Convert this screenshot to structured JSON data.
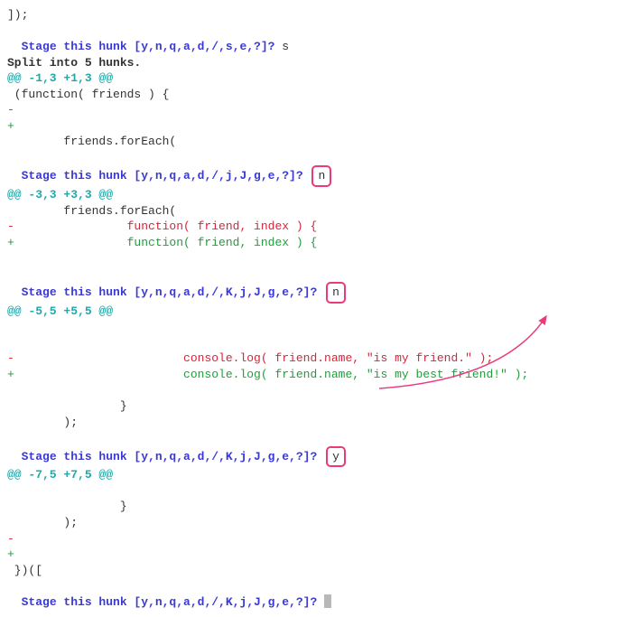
{
  "l0": "]);",
  "p1": "Stage this hunk [y,n,q,a,d,/,s,e,?]?",
  "a1": " s",
  "split": "Split into 5 hunks.",
  "h1": "@@ -1,3 +1,3 @@",
  "c1": " (function( friends ) {",
  "minus_blank": "-",
  "plus_blank": "+",
  "c2": "        friends.forEach(",
  "p2": "Stage this hunk [y,n,q,a,d,/,j,J,g,e,?]?",
  "a2": "n",
  "h2": "@@ -3,3 +3,3 @@",
  "c3": "        friends.forEach(",
  "rm_fn": "-                function( friend, index ) {",
  "ad_fn": "+                function( friend, index ) {",
  "p3": "Stage this hunk [y,n,q,a,d,/,K,j,J,g,e,?]?",
  "a3": "n",
  "h3": "@@ -5,5 +5,5 @@",
  "rm_log": "-                        console.log( friend.name, \"is my friend.\" );",
  "ad_log": "+                        console.log( friend.name, \"is my best friend!\" );",
  "c4": "                }",
  "c5": "        );",
  "p4": "Stage this hunk [y,n,q,a,d,/,K,j,J,g,e,?]?",
  "a4": "y",
  "h4": "@@ -7,5 +7,5 @@",
  "c6": "                }",
  "c7": "        );",
  "minus_blank2": "-",
  "plus_blank2": "+",
  "c8": " })([",
  "p5": "Stage this hunk [y,n,q,a,d,/,K,j,J,g,e,?]?"
}
